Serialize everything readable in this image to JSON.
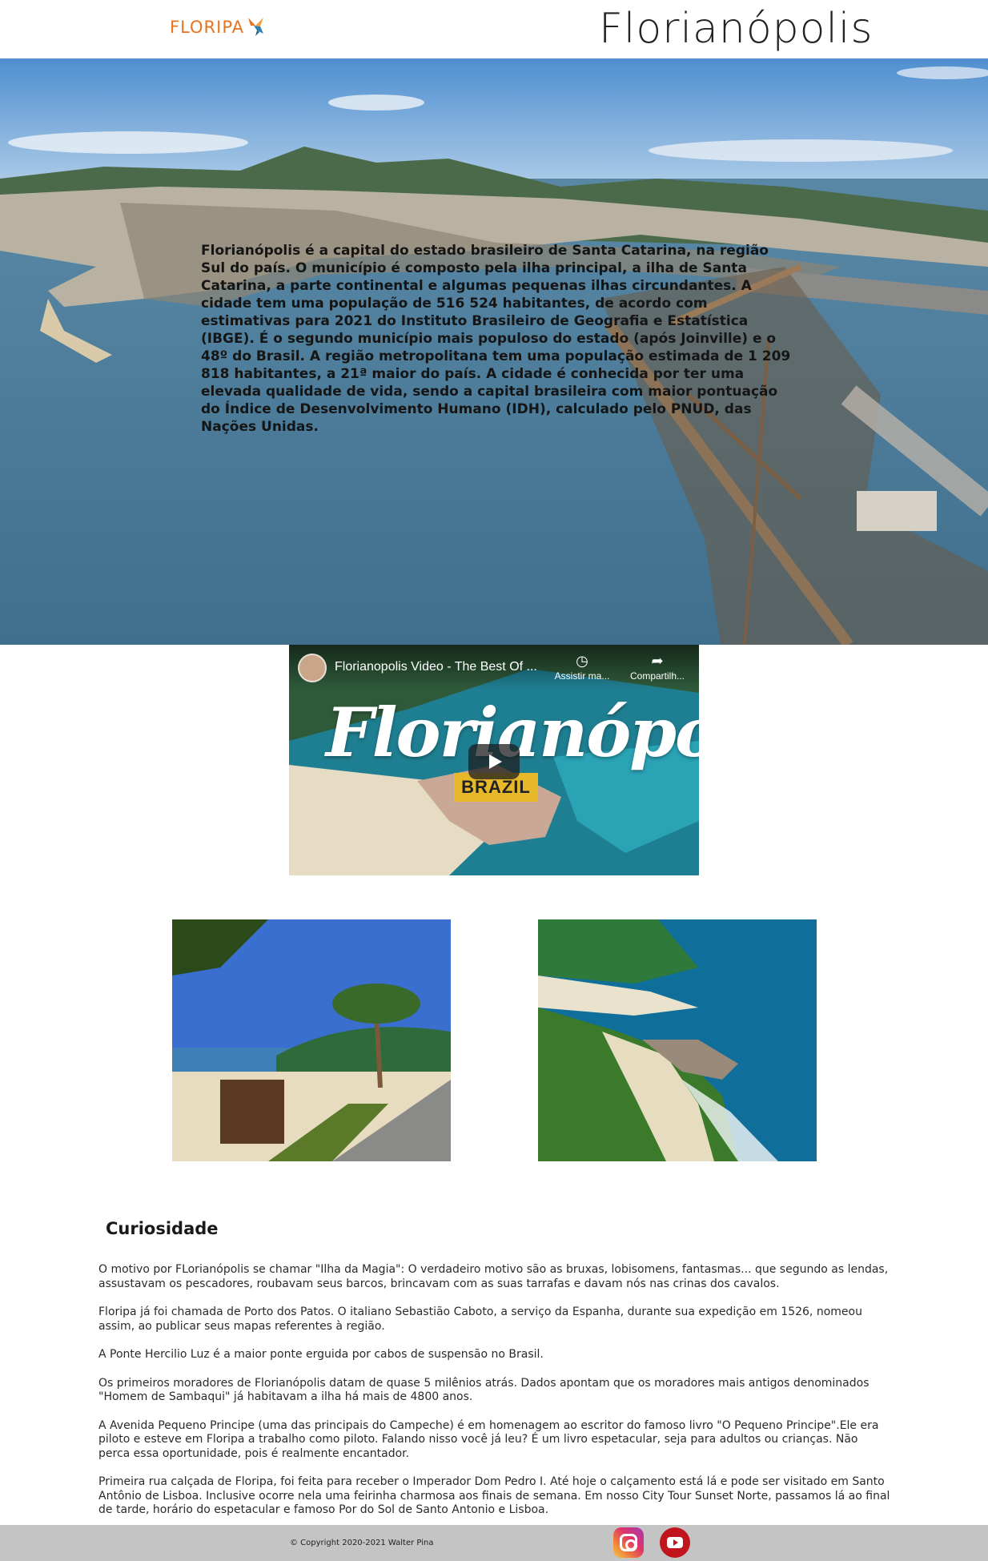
{
  "header": {
    "logo_text": "FLORIPA",
    "logo_icon": "bird-icon",
    "title": "Florianópolis"
  },
  "hero": {
    "image": "aerial-city-bridge-photo",
    "text": "Florianópolis é a capital do estado brasileiro de Santa Catarina, na região Sul do país. O município é composto pela ilha principal, a ilha de Santa Catarina, a parte continental e algumas pequenas ilhas circundantes. A cidade tem uma população de 516 524 habitantes, de acordo com estimativas para 2021 do Instituto Brasileiro de Geografia e Estatística (IBGE). É o segundo município mais populoso do estado (após Joinville) e o 48º do Brasil. A região metropolitana tem uma população estimada de 1 209 818 habitantes, a 21ª maior do país. A cidade é conhecida por ter uma elevada qualidade de vida, sendo a capital brasileira com maior pontuação do Índice de Desenvolvimento Humano (IDH), calculado pelo PNUD, das Nações Unidas."
  },
  "video": {
    "title": "Florianopolis Video - The Best Of ...",
    "watch_later": "Assistir ma...",
    "share": "Compartilh...",
    "thumbnail_script": "Florianópolis",
    "thumbnail_badge": "BRAZIL",
    "play_icon": "play-icon"
  },
  "photos": {
    "left": "beach-boardwalk-palm-photo",
    "right": "coastline-beach-aerial-photo"
  },
  "curiosidade": {
    "title": "Curiosidade",
    "items": [
      "O motivo por FLorianópolis se chamar \"Ilha da Magia\": O verdadeiro motivo são as bruxas, lobisomens, fantasmas... que segundo as lendas, assustavam os pescadores, roubavam seus barcos, brincavam com as suas tarrafas e davam nós nas crinas dos cavalos.",
      "Floripa já foi chamada de Porto dos Patos. O italiano Sebastião Caboto, a serviço da Espanha, durante sua expedição em 1526, nomeou assim, ao publicar seus mapas referentes à região.",
      "A Ponte Hercilio Luz é a maior ponte erguida por cabos de suspensão no Brasil.",
      "Os primeiros moradores de Florianópolis datam de quase 5 milênios atrás. Dados apontam que os moradores mais antigos denominados \"Homem de Sambaqui\" já habitavam a ilha há mais de 4800 anos.",
      "A Avenida Pequeno Principe (uma das principais do Campeche) é em homenagem ao escritor do famoso livro \"O Pequeno Principe\".Ele era piloto e esteve em Floripa a trabalho como piloto. Falando nisso você já leu? É um livro espetacular, seja para adultos ou crianças. Não perca essa oportunidade, pois é realmente encantador.",
      "Primeira rua calçada de Floripa, foi feita para receber o Imperador Dom Pedro I. Até hoje o calçamento está lá e pode ser visitado em Santo Antônio de Lisboa. Inclusive ocorre nela uma feirinha charmosa aos finais de semana. Em nosso City Tour Sunset Norte, passamos lá ao final de tarde, horário do espetacular e famoso Por do Sol de Santo Antonio e Lisboa."
    ]
  },
  "footer": {
    "copyright": "© Copyright 2020-2021 Walter Pina",
    "social": [
      "instagram-icon",
      "youtube-icon"
    ]
  }
}
